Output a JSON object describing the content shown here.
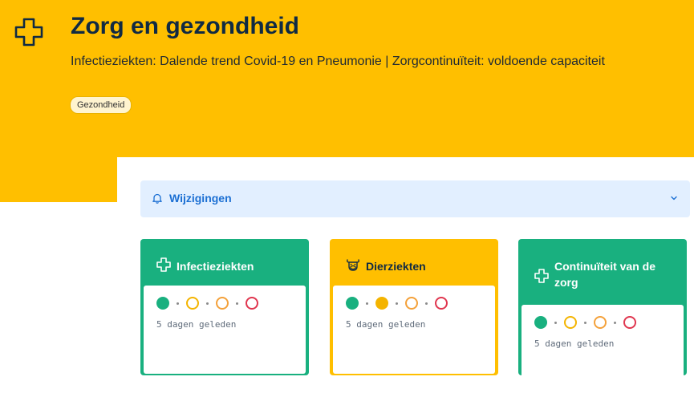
{
  "header": {
    "title": "Zorg en gezondheid",
    "subtitle": "Infectieziekten: Dalende trend Covid-19 en Pneumonie | Zorgcontinuïteit: voldoende capaciteit",
    "tag": "Gezondheid",
    "icon": "medical-cross-icon",
    "background": "#ffbf00"
  },
  "changes": {
    "label": "Wijzigingen",
    "icon": "bell-icon",
    "expand_icon": "chevron-down-icon",
    "background": "#e2efff"
  },
  "status_colors": {
    "green": "#19b07f",
    "yellow": "#f4b400",
    "orange": "#f4a13a",
    "red": "#e0364f",
    "grey": "#8a8a8a"
  },
  "cards": [
    {
      "title": "Infectieziekten",
      "icon": "medical-cross-icon",
      "theme": "green",
      "status": [
        "green-filled",
        "yellow-outline",
        "orange-outline",
        "red-outline"
      ],
      "timestamp": "5 dagen geleden"
    },
    {
      "title": "Dierziekten",
      "icon": "cow-icon",
      "theme": "yellow",
      "status": [
        "green-filled",
        "yellow-filled",
        "orange-outline",
        "red-outline"
      ],
      "timestamp": "5 dagen geleden"
    },
    {
      "title": "Continuïteit van de zorg",
      "icon": "medical-cross-icon",
      "theme": "green",
      "status": [
        "green-filled",
        "yellow-outline",
        "orange-outline",
        "red-outline"
      ],
      "timestamp": "5 dagen geleden"
    }
  ]
}
